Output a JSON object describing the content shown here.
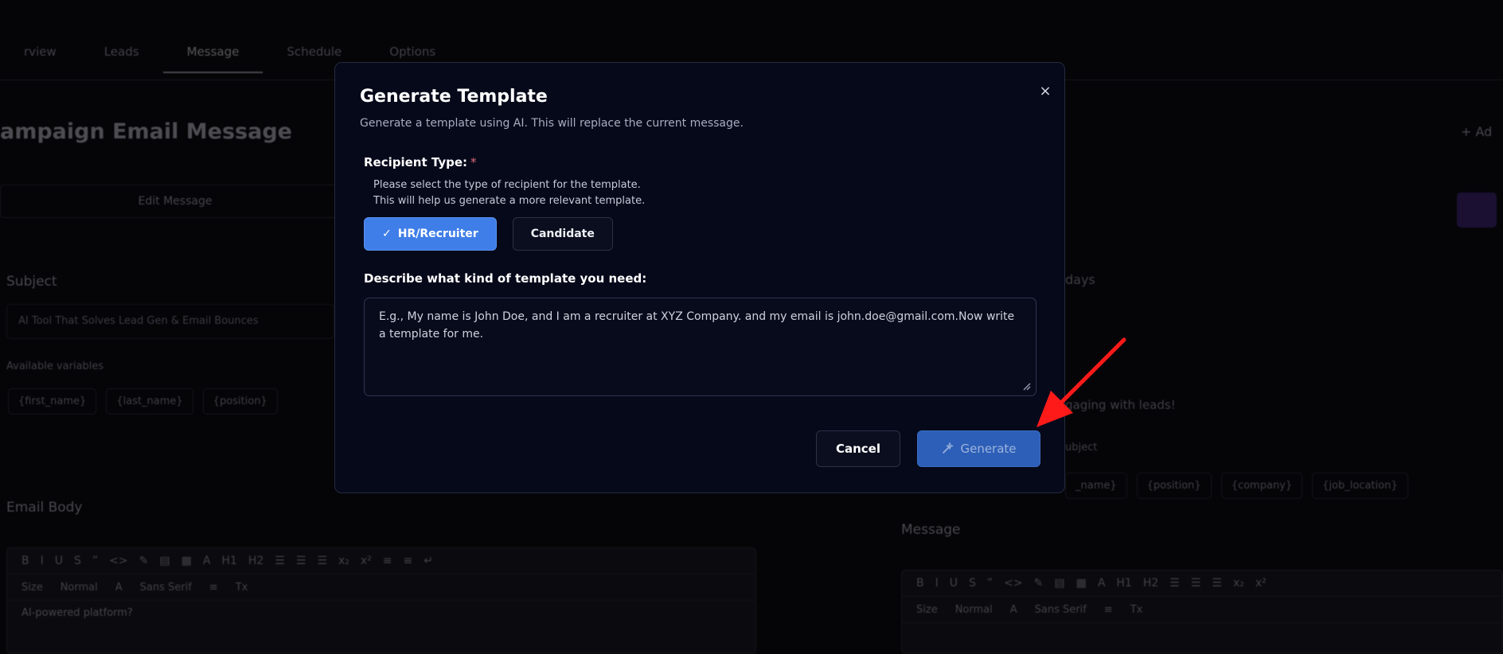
{
  "tabs": [
    "rview",
    "Leads",
    "Message",
    "Schedule",
    "Options"
  ],
  "active_tab": "Message",
  "background": {
    "page_title": "ampaign Email Message",
    "edit_tab": "Edit Message",
    "subject_label": "Subject",
    "subject_value": "AI Tool That Solves Lead Gen & Email Bounces",
    "available_variables": "Available variables",
    "variables": [
      "{first_name}",
      "{last_name}",
      "{position}"
    ],
    "email_body_label": "Email Body",
    "email_body_text": "AI-powered platform?",
    "right_days_label": "days",
    "right_text": "gaging with leads!",
    "right_subject": "ubject",
    "right_variables": [
      "_name}",
      "{position}",
      "{company}",
      "{job_location}"
    ],
    "message_label": "Message",
    "add_button": "+ Ad",
    "toolbar_row1": [
      "B",
      "I",
      "U",
      "S",
      "”",
      "<>",
      "✎",
      "▤",
      "▦",
      "A",
      "H1",
      "H2",
      "☰",
      "☰",
      "☰",
      "x₂",
      "x²",
      "≡",
      "≡",
      "↵"
    ],
    "toolbar_row2": [
      "Size",
      "Normal",
      "A",
      "Sans Serif",
      "≡",
      "Tx"
    ]
  },
  "modal": {
    "title": "Generate Template",
    "subtitle": "Generate a template using AI. This will replace the current message.",
    "close_glyph": "×",
    "recipient_label": "Recipient Type:",
    "recipient_required": "*",
    "recipient_help_1": "Please select the type of recipient for the template.",
    "recipient_help_2": "This will help us generate a more relevant template.",
    "options": [
      {
        "label": "HR/Recruiter",
        "selected": true
      },
      {
        "label": "Candidate",
        "selected": false
      }
    ],
    "check_glyph": "✓",
    "describe_label": "Describe what kind of template you need:",
    "describe_placeholder": "E.g., My name is John Doe, and I am a recruiter at XYZ Company. and my email is john.doe@gmail.com.Now write a template for me.",
    "cancel_label": "Cancel",
    "generate_label": "Generate"
  },
  "colors": {
    "primary_blue": "#3f7ee8",
    "generate_blue": "#2d5fb8",
    "annotation_red": "#ff1a1a",
    "modal_bg": "#06091a"
  }
}
